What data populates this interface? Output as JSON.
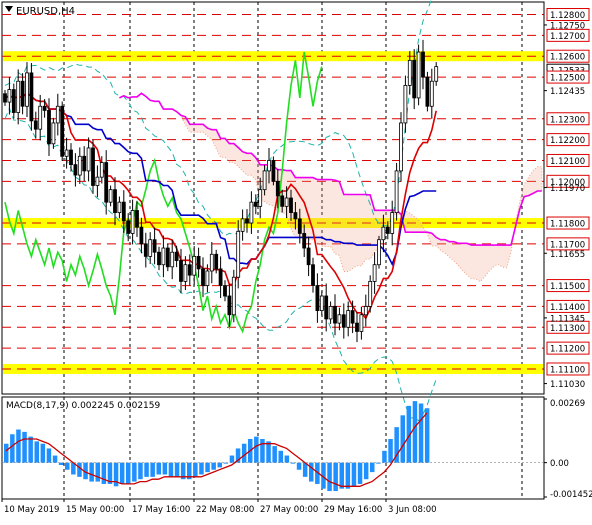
{
  "window": {
    "title": "EURUSD,H4"
  },
  "price_panel": {
    "price_ticks": [
      "1.12750",
      "1.12435",
      "1.11970",
      "1.11655",
      "1.11345",
      "1.11030"
    ],
    "level_labels": [
      {
        "text": "1.12800",
        "price": 1.128,
        "kind": "resistance"
      },
      {
        "text": "1.12700",
        "price": 1.127,
        "kind": "resistance"
      },
      {
        "text": "1.12600",
        "price": 1.126,
        "kind": "key-level"
      },
      {
        "text": "1.12533",
        "price": 1.12533,
        "kind": "current"
      },
      {
        "text": "1.12500",
        "price": 1.125,
        "kind": "resistance"
      },
      {
        "text": "1.12300",
        "price": 1.123,
        "kind": "resistance"
      },
      {
        "text": "1.12200",
        "price": 1.122,
        "kind": "resistance"
      },
      {
        "text": "1.12100",
        "price": 1.121,
        "kind": "resistance"
      },
      {
        "text": "1.12000",
        "price": 1.12,
        "kind": "resistance"
      },
      {
        "text": "1.11800",
        "price": 1.118,
        "kind": "key-level"
      },
      {
        "text": "1.11700",
        "price": 1.117,
        "kind": "resistance"
      },
      {
        "text": "1.11500",
        "price": 1.115,
        "kind": "resistance"
      },
      {
        "text": "1.11400",
        "price": 1.114,
        "kind": "resistance"
      },
      {
        "text": "1.11300",
        "price": 1.113,
        "kind": "resistance"
      },
      {
        "text": "1.11200",
        "price": 1.112,
        "kind": "resistance"
      },
      {
        "text": "1.11100",
        "price": 1.111,
        "kind": "key-level"
      }
    ]
  },
  "macd_panel": {
    "label": "MACD(8,17,9) 0.002245 0.002159",
    "ticks": [
      "0.00269",
      "0.00",
      "-0.001452"
    ]
  },
  "time_axis": {
    "labels": [
      "10 May 2019",
      "15 May 00:00",
      "17 May 16:00",
      "22 May 08:00",
      "27 May 00:00",
      "29 May 16:00",
      "3 Jun 08:00"
    ]
  },
  "colors": {
    "background": "#ffffff",
    "grid": "#000000",
    "level_line": "#dd0000",
    "key_level_band": "#ffff00",
    "candle": "#000000",
    "tenkan": "#dd0000",
    "kijun": "#0000cc",
    "chikou": "#22dd22",
    "senkou_b": "#ee00ee",
    "bollinger": "#20b2aa",
    "cloud": "#f0a080",
    "macd_hist": "#1e90ff",
    "macd_signal": "#cc0000",
    "label_bg": "#ffffff"
  },
  "chart_data": {
    "type": "candlestick",
    "symbol": "EURUSD",
    "timeframe": "H4",
    "ylim": [
      1.1098,
      1.1286
    ],
    "x_labels": [
      "10 May 2019",
      "15 May 00:00",
      "17 May 16:00",
      "22 May 08:00",
      "27 May 00:00",
      "29 May 16:00",
      "3 Jun 08:00"
    ],
    "close": [
      1.1238,
      1.1244,
      1.1233,
      1.1248,
      1.1236,
      1.1252,
      1.1229,
      1.1225,
      1.1236,
      1.1234,
      1.1218,
      1.1228,
      1.1236,
      1.1212,
      1.1215,
      1.1208,
      1.1203,
      1.1212,
      1.1205,
      1.1216,
      1.1198,
      1.1202,
      1.1209,
      1.119,
      1.1196,
      1.1185,
      1.119,
      1.1181,
      1.1175,
      1.1186,
      1.1178,
      1.117,
      1.1164,
      1.1172,
      1.1166,
      1.116,
      1.1168,
      1.1159,
      1.1166,
      1.1162,
      1.1152,
      1.116,
      1.1155,
      1.1164,
      1.1158,
      1.115,
      1.1157,
      1.1165,
      1.1158,
      1.115,
      1.1145,
      1.1136,
      1.1154,
      1.1176,
      1.1182,
      1.118,
      1.119,
      1.1188,
      1.1196,
      1.1205,
      1.121,
      1.12,
      1.1193,
      1.1188,
      1.1192,
      1.1185,
      1.1182,
      1.1175,
      1.1168,
      1.116,
      1.115,
      1.1138,
      1.1145,
      1.1134,
      1.114,
      1.1132,
      1.1136,
      1.113,
      1.1138,
      1.1132,
      1.1128,
      1.1136,
      1.114,
      1.1152,
      1.116,
      1.1172,
      1.1178,
      1.1175,
      1.1185,
      1.1205,
      1.1228,
      1.1246,
      1.1258,
      1.124,
      1.1262,
      1.125,
      1.1236,
      1.1248,
      1.1255
    ],
    "support_resistance_levels": [
      1.128,
      1.127,
      1.126,
      1.125,
      1.123,
      1.122,
      1.121,
      1.12,
      1.118,
      1.117,
      1.115,
      1.114,
      1.113,
      1.112,
      1.111
    ],
    "highlighted_levels": [
      1.126,
      1.118,
      1.111
    ],
    "current_price": 1.12533,
    "indicators": {
      "ichimoku": {
        "tenkan": "red",
        "kijun": "blue",
        "chikou": "green",
        "senkou_b": "magenta",
        "cloud": "shaded"
      },
      "bollinger_bands": "dashed teal"
    },
    "macd": {
      "params": [
        8,
        17,
        9
      ],
      "main": 0.002245,
      "signal": 0.002159,
      "ylim": [
        -0.001452,
        0.00269
      ],
      "hist": [
        0.0008,
        0.0012,
        0.0014,
        0.0013,
        0.0011,
        0.0009,
        0.0008,
        0.0006,
        0.0003,
        -0.0001,
        -0.0003,
        -0.0005,
        -0.0006,
        -0.0007,
        -0.0008,
        -0.0008,
        -0.0009,
        -0.0009,
        -0.001,
        -0.0009,
        -0.0009,
        -0.0008,
        -0.0007,
        -0.0006,
        -0.0006,
        -0.0005,
        -0.0005,
        -0.0006,
        -0.0006,
        -0.0007,
        -0.0007,
        -0.0006,
        -0.0005,
        -0.0004,
        -0.0003,
        -0.0002,
        0.0,
        0.0003,
        0.0006,
        0.0008,
        0.001,
        0.0011,
        0.001,
        0.0009,
        0.0007,
        0.0005,
        0.0003,
        0.0,
        -0.0003,
        -0.0006,
        -0.0008,
        -0.0009,
        -0.0011,
        -0.0012,
        -0.0012,
        -0.0011,
        -0.0011,
        -0.001,
        -0.0009,
        -0.0007,
        -0.0004,
        0.0,
        0.0005,
        0.001,
        0.0015,
        0.002,
        0.0024,
        0.0026,
        0.0025,
        0.0023
      ],
      "signal_line": [
        0.0005,
        0.0007,
        0.0009,
        0.001,
        0.001,
        0.001,
        0.0009,
        0.0008,
        0.0006,
        0.0004,
        0.0002,
        0.0,
        -0.0002,
        -0.0004,
        -0.0005,
        -0.0006,
        -0.0007,
        -0.0008,
        -0.0008,
        -0.0009,
        -0.0009,
        -0.0009,
        -0.0008,
        -0.0008,
        -0.0007,
        -0.0007,
        -0.0006,
        -0.0006,
        -0.0006,
        -0.0006,
        -0.0006,
        -0.0006,
        -0.0006,
        -0.0005,
        -0.0004,
        -0.0003,
        -0.0002,
        -0.0001,
        0.0001,
        0.0003,
        0.0005,
        0.0007,
        0.0008,
        0.0008,
        0.0008,
        0.0007,
        0.0006,
        0.0004,
        0.0002,
        0.0,
        -0.0002,
        -0.0004,
        -0.0006,
        -0.0008,
        -0.0009,
        -0.001,
        -0.001,
        -0.001,
        -0.001,
        -0.0009,
        -0.0008,
        -0.0006,
        -0.0004,
        -0.0001,
        0.0003,
        0.0007,
        0.0011,
        0.0015,
        0.0018,
        0.0021
      ]
    }
  }
}
